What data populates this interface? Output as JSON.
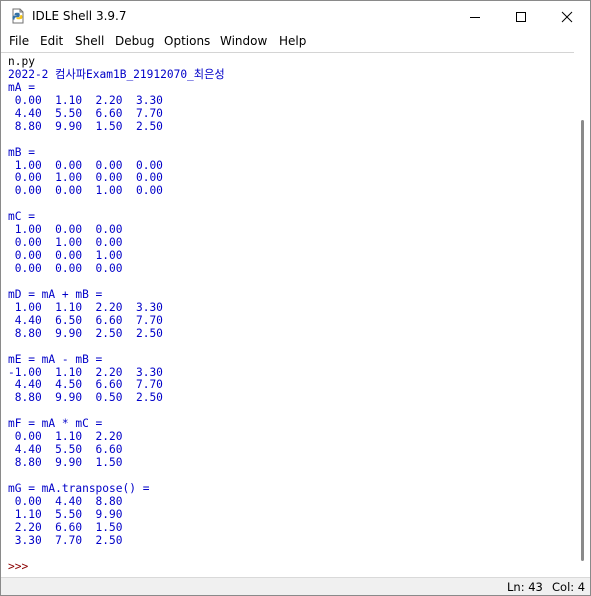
{
  "window": {
    "title": "IDLE Shell 3.9.7",
    "controls": {
      "minimize": "–",
      "maximize": "□",
      "close": "×"
    }
  },
  "menubar": {
    "items": [
      "File",
      "Edit",
      "Shell",
      "Debug",
      "Options",
      "Window",
      "Help"
    ]
  },
  "shell": {
    "lines": [
      {
        "text": "n.py",
        "kind": "stdin"
      },
      {
        "text": "2022-2 컴사파Exam1B_21912070_최은성",
        "kind": "out"
      },
      {
        "text": "mA =",
        "kind": "out"
      },
      {
        "text": " 0.00  1.10  2.20  3.30",
        "kind": "out"
      },
      {
        "text": " 4.40  5.50  6.60  7.70",
        "kind": "out"
      },
      {
        "text": " 8.80  9.90  1.50  2.50",
        "kind": "out"
      },
      {
        "text": "",
        "kind": "out"
      },
      {
        "text": "mB =",
        "kind": "out"
      },
      {
        "text": " 1.00  0.00  0.00  0.00",
        "kind": "out"
      },
      {
        "text": " 0.00  1.00  0.00  0.00",
        "kind": "out"
      },
      {
        "text": " 0.00  0.00  1.00  0.00",
        "kind": "out"
      },
      {
        "text": "",
        "kind": "out"
      },
      {
        "text": "mC =",
        "kind": "out"
      },
      {
        "text": " 1.00  0.00  0.00",
        "kind": "out"
      },
      {
        "text": " 0.00  1.00  0.00",
        "kind": "out"
      },
      {
        "text": " 0.00  0.00  1.00",
        "kind": "out"
      },
      {
        "text": " 0.00  0.00  0.00",
        "kind": "out"
      },
      {
        "text": "",
        "kind": "out"
      },
      {
        "text": "mD = mA + mB =",
        "kind": "out"
      },
      {
        "text": " 1.00  1.10  2.20  3.30",
        "kind": "out"
      },
      {
        "text": " 4.40  6.50  6.60  7.70",
        "kind": "out"
      },
      {
        "text": " 8.80  9.90  2.50  2.50",
        "kind": "out"
      },
      {
        "text": "",
        "kind": "out"
      },
      {
        "text": "mE = mA - mB =",
        "kind": "out"
      },
      {
        "text": "-1.00  1.10  2.20  3.30",
        "kind": "out"
      },
      {
        "text": " 4.40  4.50  6.60  7.70",
        "kind": "out"
      },
      {
        "text": " 8.80  9.90  0.50  2.50",
        "kind": "out"
      },
      {
        "text": "",
        "kind": "out"
      },
      {
        "text": "mF = mA * mC =",
        "kind": "out"
      },
      {
        "text": " 0.00  1.10  2.20",
        "kind": "out"
      },
      {
        "text": " 4.40  5.50  6.60",
        "kind": "out"
      },
      {
        "text": " 8.80  9.90  1.50",
        "kind": "out"
      },
      {
        "text": "",
        "kind": "out"
      },
      {
        "text": "mG = mA.transpose() =",
        "kind": "out"
      },
      {
        "text": " 0.00  4.40  8.80",
        "kind": "out"
      },
      {
        "text": " 1.10  5.50  9.90",
        "kind": "out"
      },
      {
        "text": " 2.20  6.60  1.50",
        "kind": "out"
      },
      {
        "text": " 3.30  7.70  2.50",
        "kind": "out"
      },
      {
        "text": "",
        "kind": "out"
      },
      {
        "text": ">>>",
        "kind": "prompt"
      }
    ]
  },
  "statusbar": {
    "ln": "Ln: 43",
    "col": "Col: 4"
  },
  "colors": {
    "output": "#0000c8",
    "prompt": "#8b0000",
    "stdin": "#000000"
  }
}
